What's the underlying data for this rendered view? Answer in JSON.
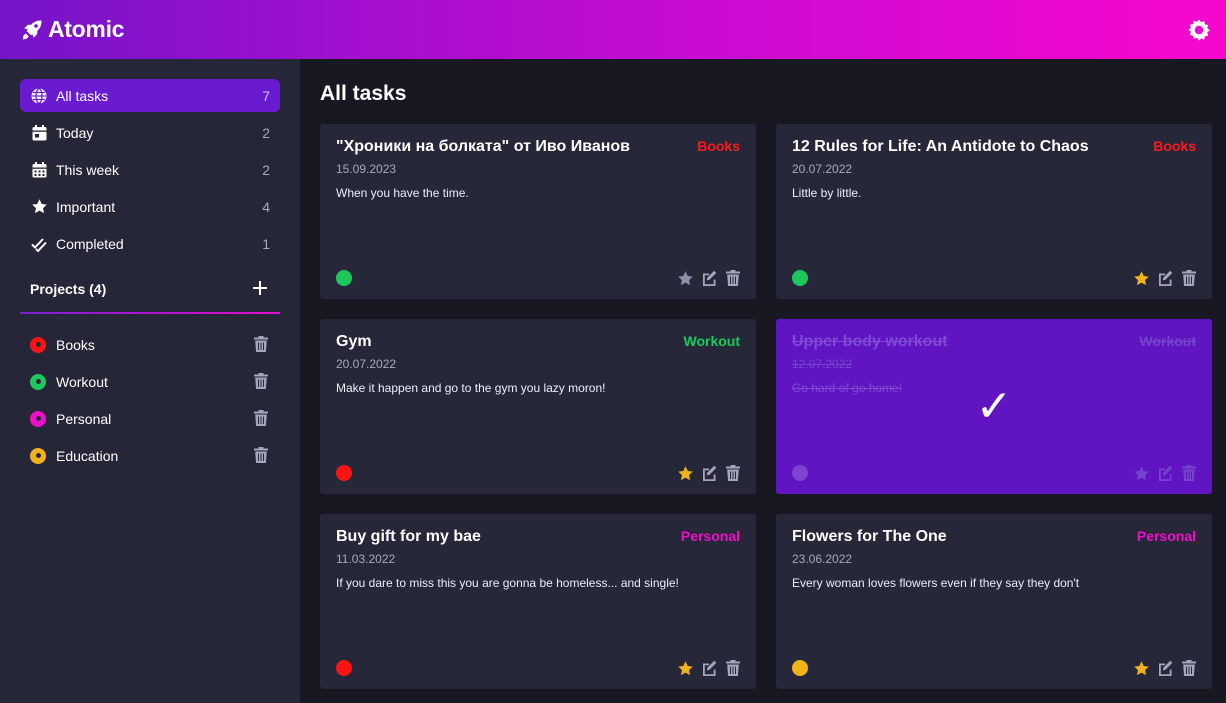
{
  "app": {
    "title": "Atomic"
  },
  "sidebar": {
    "nav": [
      {
        "label": "All tasks",
        "count": "7",
        "icon": "globe-icon"
      },
      {
        "label": "Today",
        "count": "2",
        "icon": "calendar-day-icon"
      },
      {
        "label": "This week",
        "count": "2",
        "icon": "calendar-week-icon"
      },
      {
        "label": "Important",
        "count": "4",
        "icon": "star-icon"
      },
      {
        "label": "Completed",
        "count": "1",
        "icon": "double-check-icon"
      }
    ],
    "projects_title": "Projects (4)",
    "projects": [
      {
        "label": "Books",
        "color": "#ff1414"
      },
      {
        "label": "Workout",
        "color": "#1dc95d"
      },
      {
        "label": "Personal",
        "color": "#ef0fc6"
      },
      {
        "label": "Education",
        "color": "#f2b21a"
      }
    ]
  },
  "main": {
    "title": "All tasks",
    "tasks": [
      {
        "title": "\"Хроники на болката\" от Иво Иванов",
        "project": "Books",
        "project_color": "#ff1a1a",
        "date": "15.09.2023",
        "description": "When you have the time.",
        "status_color": "#1dc95d",
        "important": false,
        "completed": false
      },
      {
        "title": "12 Rules for Life: An Antidote to Chaos",
        "project": "Books",
        "project_color": "#ff1a1a",
        "date": "20.07.2022",
        "description": "Little by little.",
        "status_color": "#1dc95d",
        "important": true,
        "completed": false
      },
      {
        "title": "Gym",
        "project": "Workout",
        "project_color": "#1dc95d",
        "date": "20.07.2022",
        "description": "Make it happen and go to the gym you lazy moron!",
        "status_color": "#ff1414",
        "important": true,
        "completed": false
      },
      {
        "title": "Upper body workout",
        "project": "Workout",
        "project_color": "#7a46d0",
        "date": "12.07.2022",
        "description": "Go hard of go home!",
        "status_color": "#7b45d0",
        "important": false,
        "completed": true,
        "check": "✓"
      },
      {
        "title": "Buy gift for my bae",
        "project": "Personal",
        "project_color": "#ef0fc6",
        "date": "11.03.2022",
        "description": "If you dare to miss this you are gonna be homeless... and single!",
        "status_color": "#ff1414",
        "important": true,
        "completed": false
      },
      {
        "title": "Flowers for The One",
        "project": "Personal",
        "project_color": "#ef0fc6",
        "date": "23.06.2022",
        "description": "Every woman loves flowers even if they say they don't",
        "status_color": "#f2b21a",
        "important": true,
        "completed": false
      }
    ]
  },
  "colors": {
    "accent": "#6a1bd0",
    "star_on": "#f2b21a",
    "star_off": "#8d90a8",
    "icon": "#a3a6bd"
  }
}
